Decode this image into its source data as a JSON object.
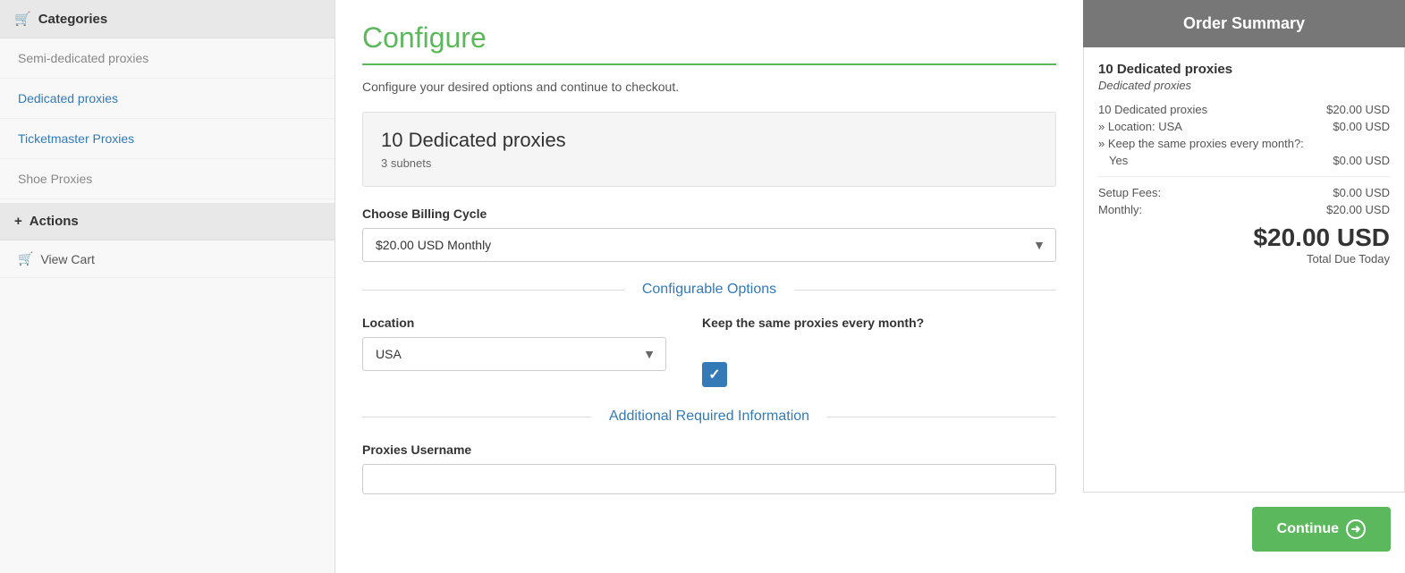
{
  "sidebar": {
    "categories_label": "Categories",
    "cart_icon": "🛒",
    "plus_icon": "+",
    "items": [
      {
        "label": "Semi-dedicated proxies",
        "active": false
      },
      {
        "label": "Dedicated proxies",
        "active": true
      },
      {
        "label": "Ticketmaster Proxies",
        "active": false
      },
      {
        "label": "Shoe Proxies",
        "active": false
      }
    ],
    "actions_label": "Actions",
    "view_cart_label": "View Cart"
  },
  "main": {
    "page_title": "Configure",
    "subtitle": "Configure your desired options and continue to checkout.",
    "product": {
      "name": "10 Dedicated proxies",
      "subnets": "3 subnets"
    },
    "billing_cycle_label": "Choose Billing Cycle",
    "billing_cycle_option": "$20.00 USD Monthly",
    "configurable_options_label": "Configurable Options",
    "location_label": "Location",
    "location_option": "USA",
    "same_proxies_label": "Keep the same proxies every month?",
    "additional_info_label": "Additional Required Information",
    "proxies_username_label": "Proxies Username"
  },
  "order_summary": {
    "header": "Order Summary",
    "product_title": "10 Dedicated proxies",
    "product_subtitle": "Dedicated proxies",
    "lines": [
      {
        "label": "10 Dedicated proxies",
        "value": "$20.00 USD"
      },
      {
        "label": "» Location: USA",
        "value": "$0.00 USD"
      },
      {
        "label": "» Keep the same proxies every month?:",
        "value": ""
      },
      {
        "label": "Yes",
        "value": "$0.00 USD"
      }
    ],
    "setup_fees_label": "Setup Fees:",
    "setup_fees_value": "$0.00 USD",
    "monthly_label": "Monthly:",
    "monthly_value": "$20.00 USD",
    "total_amount": "$20.00 USD",
    "total_due_label": "Total Due Today",
    "continue_label": "Continue"
  }
}
